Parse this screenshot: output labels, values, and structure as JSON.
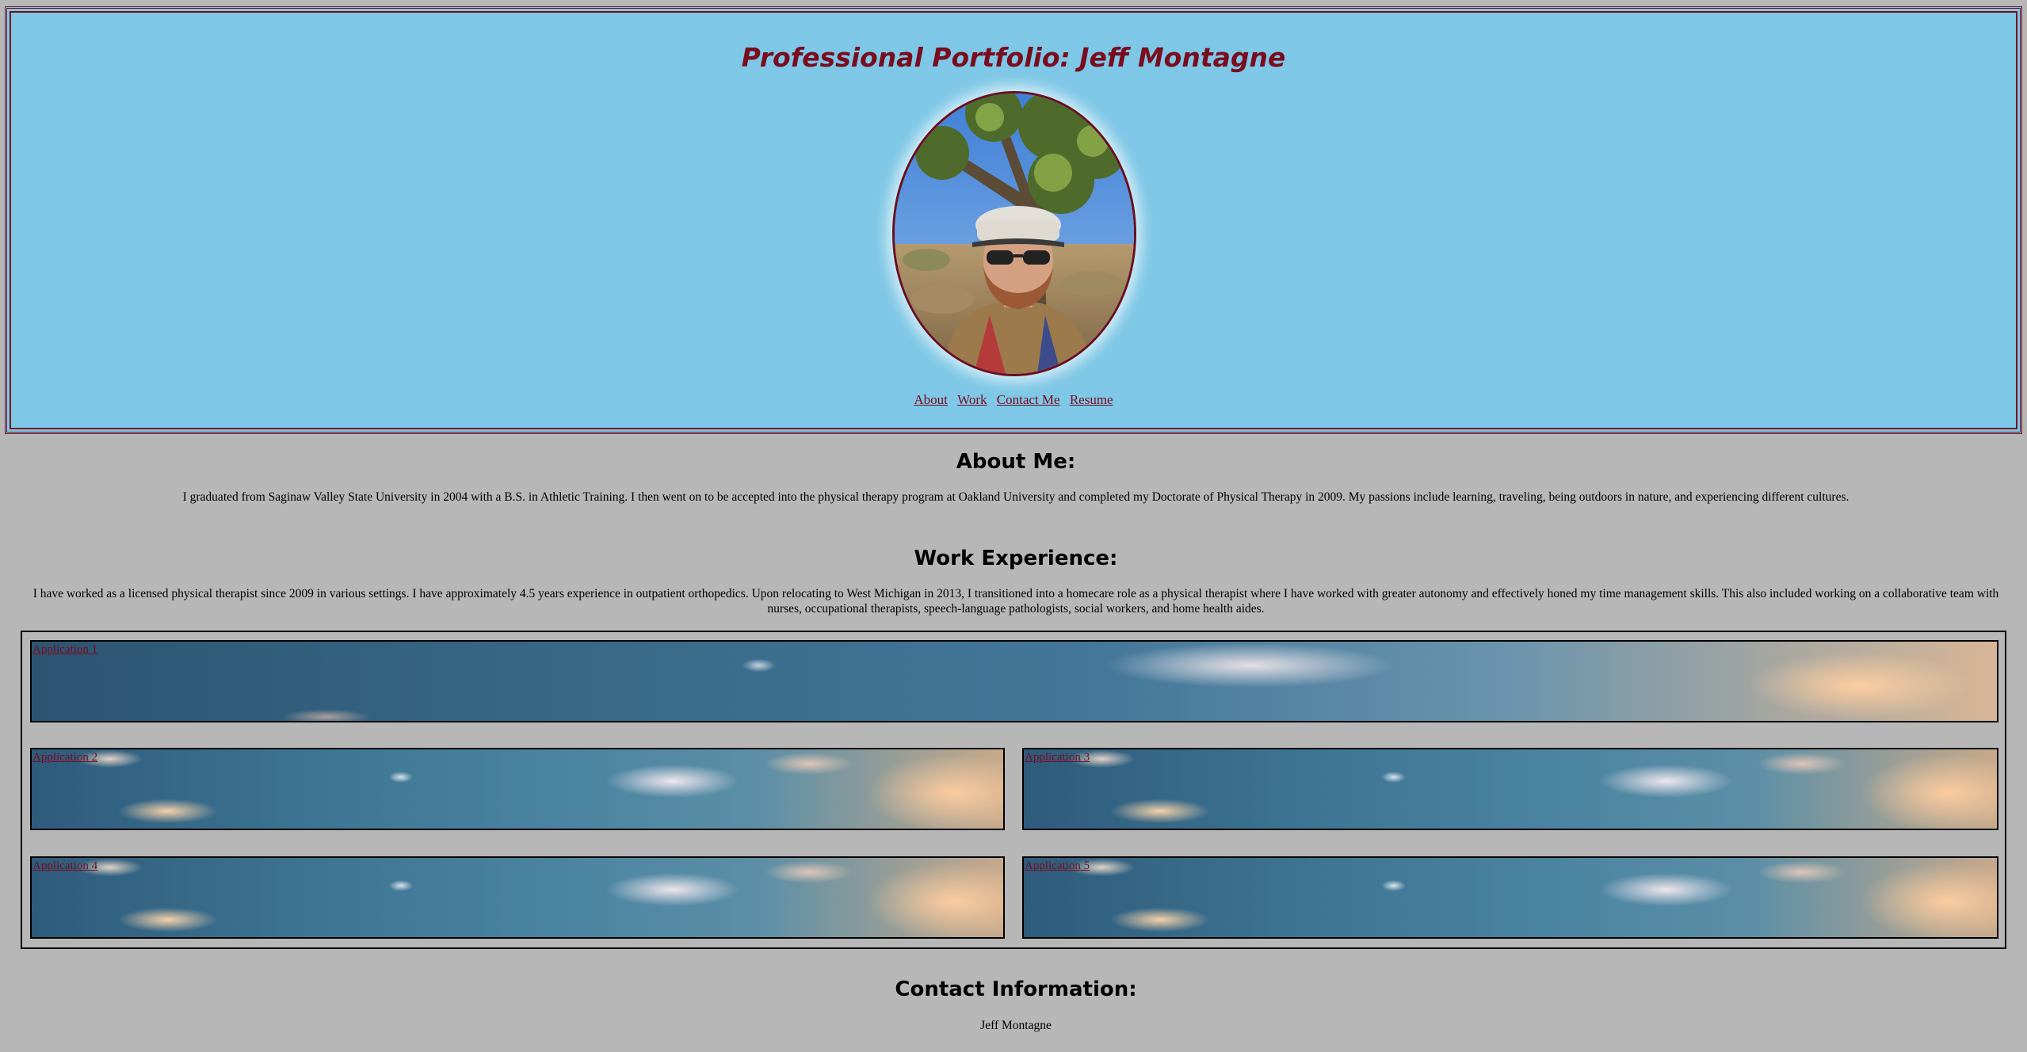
{
  "header": {
    "title": "Professional Portfolio: Jeff Montagne",
    "nav": [
      "About",
      "Work",
      "Contact Me",
      "Resume"
    ]
  },
  "about": {
    "heading": "About Me:",
    "text": "I graduated from Saginaw Valley State University in 2004 with a B.S. in Athletic Training. I then went on to be accepted into the physical therapy program at Oakland University and completed my Doctorate of Physical Therapy in 2009. My passions include learning, traveling, being outdoors in nature, and experiencing different cultures."
  },
  "work": {
    "heading": "Work Experience:",
    "text": "I have worked as a licensed physical therapist since 2009 in various settings. I have approximately 4.5 years experience in outpatient orthopedics. Upon relocating to West Michigan in 2013, I transitioned into a homecare role as a physical therapist where I have worked with greater autonomy and effectively honed my time management skills. This also included working on a collaborative team with nurses, occupational therapists, speech-language pathologists, social workers, and home health aides.",
    "applications": [
      "Application 1",
      "Application 2",
      "Application 3",
      "Application 4",
      "Application 5"
    ]
  },
  "contact": {
    "heading": "Contact Information:",
    "name": "Jeff Montagne"
  },
  "colors": {
    "header_bg": "#7ec7e6",
    "accent": "#7a0c1e",
    "page_bg": "#b7b7b7"
  }
}
